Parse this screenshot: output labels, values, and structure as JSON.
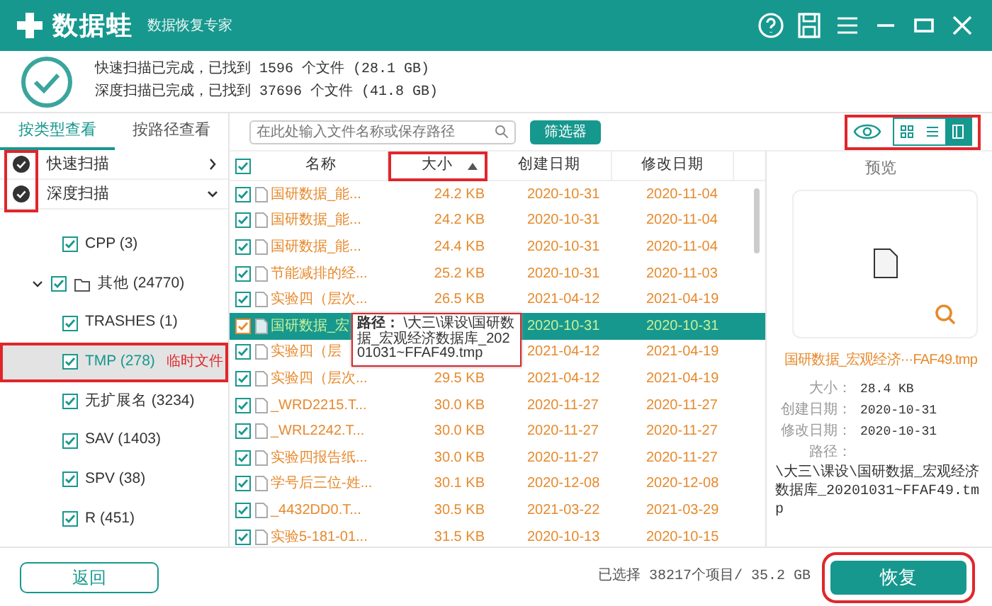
{
  "title_bar": {
    "app_name": "数据蛙",
    "subtitle": "数据恢复专家"
  },
  "scan_summary": [
    "快速扫描已完成，已找到 1596 个文件 (28.1 GB)",
    "深度扫描已完成，已找到 37696 个文件 (41.8 GB)"
  ],
  "view_tabs": [
    {
      "label": "按类型查看",
      "selected": true
    },
    {
      "label": "按路径查看",
      "selected": false
    }
  ],
  "scan_modes": {
    "highlighted": true,
    "items": [
      {
        "label": "快速扫描",
        "expanded": false
      },
      {
        "label": "深度扫描",
        "expanded": true
      }
    ]
  },
  "tree": [
    {
      "label": "CPP (3)",
      "checked": true,
      "selected": false
    },
    {
      "label": "其他 (24770)",
      "checked": true,
      "expanded": true,
      "kind": "folder",
      "selected": false,
      "children": [
        {
          "label": "TRASHES (1)",
          "checked": true,
          "selected": false
        },
        {
          "label": "TMP (278)",
          "checked": true,
          "selected": true,
          "highlighted": true,
          "note": "临时文件"
        },
        {
          "label": "无扩展名 (3234)",
          "checked": true,
          "selected": false
        },
        {
          "label": "SAV (1403)",
          "checked": true,
          "selected": false
        },
        {
          "label": "SPV (38)",
          "checked": true,
          "selected": false
        },
        {
          "label": "R (451)",
          "checked": true,
          "selected": false
        }
      ]
    }
  ],
  "search": {
    "placeholder": "在此处输入文件名称或保存路径"
  },
  "filter_button": "筛选器",
  "view_toolbar": {
    "highlighted": true,
    "preview_on": true,
    "modes": [
      {
        "kind": "grid",
        "selected": false
      },
      {
        "kind": "list",
        "selected": false
      },
      {
        "kind": "detail",
        "selected": true
      }
    ]
  },
  "table": {
    "all_checked": true,
    "columns": [
      {
        "label": "名称"
      },
      {
        "label": "大小",
        "sort_ascending": true,
        "highlighted": true
      },
      {
        "label": "创建日期"
      },
      {
        "label": "修改日期"
      }
    ],
    "rows": [
      {
        "name": "国研数据_能...",
        "size": "24.2 KB",
        "created": "2020-10-31",
        "modified": "2020-11-04",
        "checked": true,
        "selected": false
      },
      {
        "name": "国研数据_能...",
        "size": "24.2 KB",
        "created": "2020-10-31",
        "modified": "2020-11-04",
        "checked": true,
        "selected": false
      },
      {
        "name": "国研数据_能...",
        "size": "24.4 KB",
        "created": "2020-10-31",
        "modified": "2020-11-04",
        "checked": true,
        "selected": false
      },
      {
        "name": "节能减排的经...",
        "size": "25.2 KB",
        "created": "2020-10-31",
        "modified": "2020-11-03",
        "checked": true,
        "selected": false
      },
      {
        "name": "实验四（层次...",
        "size": "26.5 KB",
        "created": "2021-04-12",
        "modified": "2021-04-19",
        "checked": true,
        "selected": false
      },
      {
        "name": "国研数据_宏",
        "created": "2020-10-31",
        "modified": "2020-10-31",
        "checked": true,
        "selected": true
      },
      {
        "name": "实验四（层",
        "created": "2021-04-12",
        "modified": "2021-04-19",
        "checked": true,
        "selected": false
      },
      {
        "name": "实验四（层次...",
        "size": "29.5 KB",
        "created": "2021-04-12",
        "modified": "2021-04-19",
        "checked": true,
        "selected": false
      },
      {
        "name": "_WRD2215.T...",
        "size": "30.0 KB",
        "created": "2020-11-27",
        "modified": "2020-11-27",
        "checked": true,
        "selected": false
      },
      {
        "name": "_WRL2242.T...",
        "size": "30.0 KB",
        "created": "2020-11-27",
        "modified": "2020-11-27",
        "checked": true,
        "selected": false
      },
      {
        "name": "实验四报告纸...",
        "size": "30.0 KB",
        "created": "2020-11-27",
        "modified": "2020-11-27",
        "checked": true,
        "selected": false
      },
      {
        "name": "学号后三位-姓...",
        "size": "30.1 KB",
        "created": "2020-12-08",
        "modified": "2020-12-08",
        "checked": true,
        "selected": false
      },
      {
        "name": "_4432DD0.T...",
        "size": "30.5 KB",
        "created": "2021-03-22",
        "modified": "2021-03-29",
        "checked": true,
        "selected": false
      },
      {
        "name": "实验5-181-01...",
        "size": "31.5 KB",
        "created": "2020-10-13",
        "modified": "2020-10-15",
        "checked": true,
        "selected": false
      }
    ]
  },
  "tooltip": {
    "label": "路径：",
    "text": "\\大三\\课设\\国研数据_宏观经济数据库_20201031~FFAF49.tmp"
  },
  "preview": {
    "title": "预览",
    "file_name": "国研数据_宏观经济···FAF49.tmp",
    "properties": [
      {
        "label": "大小：",
        "value": "28.4 KB"
      },
      {
        "label": "创建日期：",
        "value": "2020-10-31"
      },
      {
        "label": "修改日期：",
        "value": "2020-10-31"
      },
      {
        "label": "路径：",
        "value": "\\大三\\课设\\国研数据_宏观经济数据库_20201031~FFAF49.tmp"
      }
    ]
  },
  "footer": {
    "back_button": "返回",
    "status": "已选择 38217个项目/ 35.2 GB",
    "recover_button": "恢复",
    "recover_highlighted": true
  }
}
